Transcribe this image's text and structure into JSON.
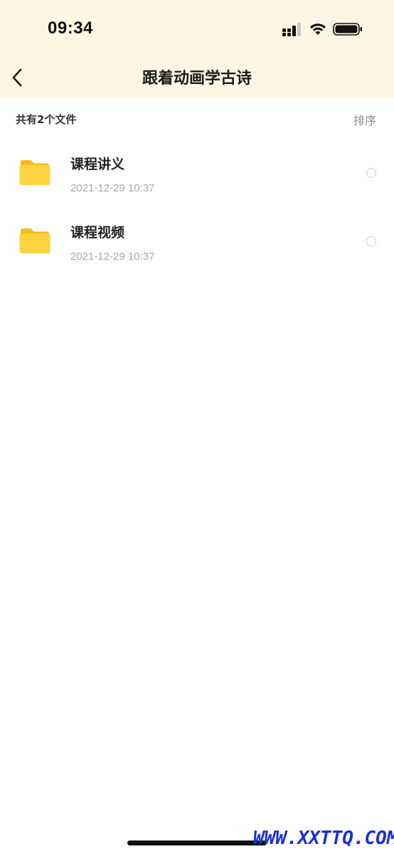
{
  "status_bar": {
    "time": "09:34",
    "icons": [
      "signal-icon",
      "wifi-icon",
      "battery-icon"
    ]
  },
  "nav": {
    "back_icon": "chevron-left-icon",
    "title": "跟着动画学古诗"
  },
  "summary": {
    "file_count": "共有2个文件",
    "sort_label": "排序"
  },
  "files": [
    {
      "name": "课程讲义",
      "date": "2021-12-29 10:37",
      "icon": "folder-icon"
    },
    {
      "name": "课程视频",
      "date": "2021-12-29 10:37",
      "icon": "folder-icon"
    }
  ],
  "watermark": "WWW.XXTTQ.COM",
  "colors": {
    "header_bg": "#fef6e3",
    "folder": "#f8c22d",
    "date_text": "#a5a8b0",
    "sort_text": "#8c8c8c",
    "watermark": "#1a2fd8"
  }
}
